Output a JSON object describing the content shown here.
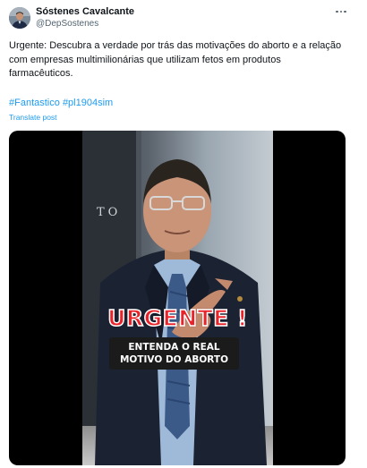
{
  "author": {
    "name": "Sóstenes Cavalcante",
    "handle": "@DepSostenes"
  },
  "post": {
    "text": "Urgente: Descubra a verdade por trás das motivações do aborto e a relação com empresas multimilionárias que utilizam fetos em produtos farmacêuticos.",
    "hashtags": [
      "#Fantastico",
      "#pl1904sim"
    ],
    "translate_label": "Translate post"
  },
  "video": {
    "background_sign": "TO",
    "overlay_title": "URGENTE !",
    "overlay_lines": [
      "ENTENDA O REAL",
      "MOTIVO DO ABORTO"
    ]
  },
  "icons": {
    "more": "more-options-icon",
    "avatar": "profile-avatar"
  },
  "colors": {
    "link": "#1d9bf0",
    "secondary_text": "#536471",
    "overlay_red": "#e8242a"
  }
}
